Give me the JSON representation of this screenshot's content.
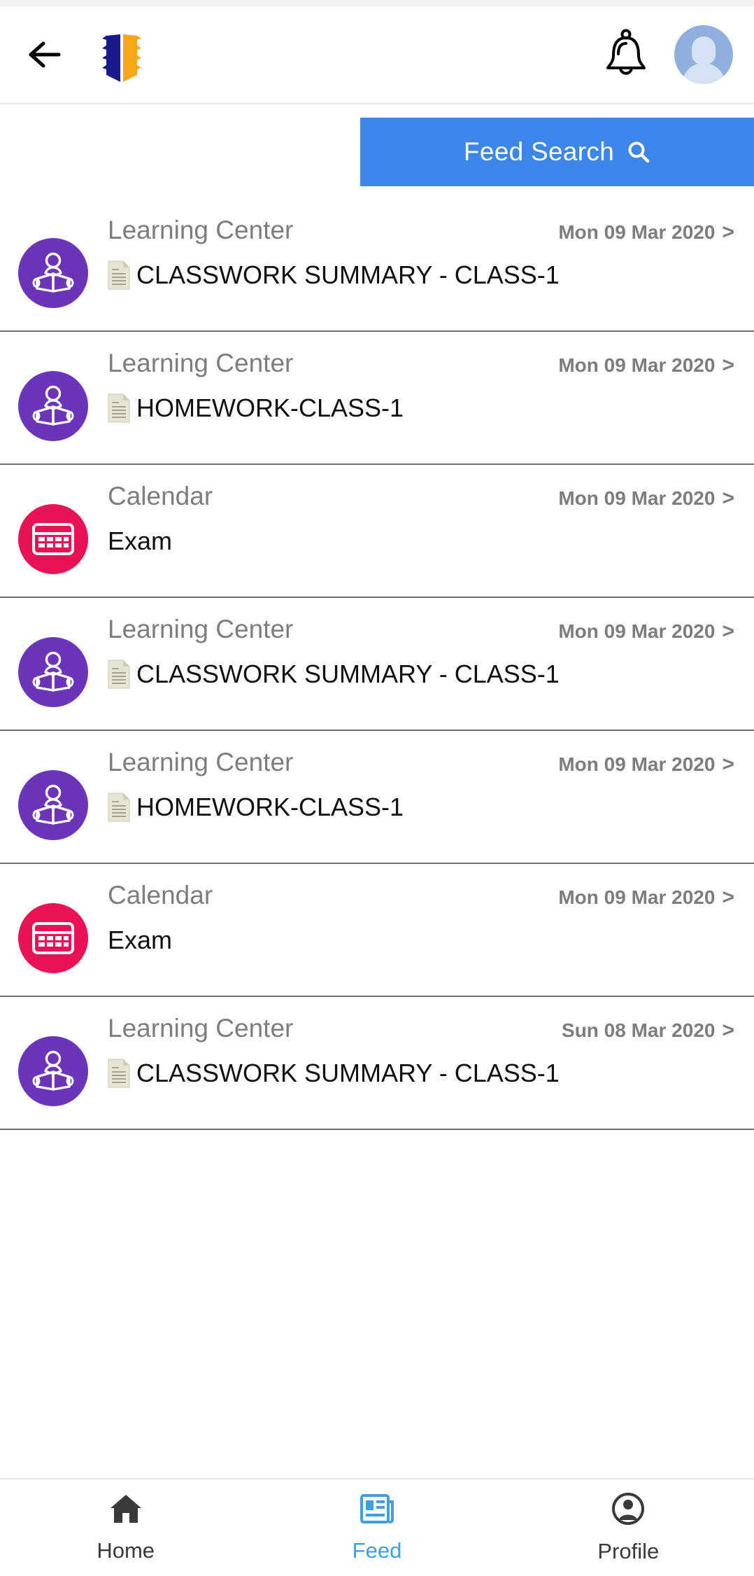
{
  "header": {
    "back_icon": "back-arrow-icon",
    "logo_icon": "open-book-logo",
    "logo_colors": {
      "left": "#1a1a8c",
      "right": "#f9a619"
    },
    "bell_icon": "notification-bell-icon",
    "avatar_icon": "user-avatar",
    "avatar_color": "#8fb0dd"
  },
  "search": {
    "label": "Feed Search",
    "icon": "search-icon",
    "background": "#3b86e8",
    "text_color": "#ffffff"
  },
  "feed": {
    "items": [
      {
        "source": "Learning Center",
        "date": "Mon 09 Mar 2020",
        "chevron": ">",
        "title": "CLASSWORK SUMMARY - CLASS-1",
        "icon": "reading-person-icon",
        "icon_color": "#6a35b8",
        "has_document_icon": true
      },
      {
        "source": "Learning Center",
        "date": "Mon 09 Mar 2020",
        "chevron": ">",
        "title": "HOMEWORK-CLASS-1",
        "icon": "reading-person-icon",
        "icon_color": "#6a35b8",
        "has_document_icon": true
      },
      {
        "source": "Calendar",
        "date": "Mon 09 Mar 2020",
        "chevron": ">",
        "title": "Exam",
        "icon": "calendar-icon",
        "icon_color": "#ea1155",
        "has_document_icon": false
      },
      {
        "source": "Learning Center",
        "date": "Mon 09 Mar 2020",
        "chevron": ">",
        "title": "CLASSWORK SUMMARY - CLASS-1",
        "icon": "reading-person-icon",
        "icon_color": "#6a35b8",
        "has_document_icon": true
      },
      {
        "source": "Learning Center",
        "date": "Mon 09 Mar 2020",
        "chevron": ">",
        "title": "HOMEWORK-CLASS-1",
        "icon": "reading-person-icon",
        "icon_color": "#6a35b8",
        "has_document_icon": true
      },
      {
        "source": "Calendar",
        "date": "Mon 09 Mar 2020",
        "chevron": ">",
        "title": "Exam",
        "icon": "calendar-icon",
        "icon_color": "#ea1155",
        "has_document_icon": false
      },
      {
        "source": "Learning Center",
        "date": "Sun 08 Mar 2020",
        "chevron": ">",
        "title": "CLASSWORK SUMMARY - CLASS-1",
        "icon": "reading-person-icon",
        "icon_color": "#6a35b8",
        "has_document_icon": true
      }
    ]
  },
  "bottom_nav": {
    "active": "Feed",
    "active_color": "#3ba0e4",
    "items": [
      {
        "label": "Home",
        "icon": "home-icon",
        "active": false
      },
      {
        "label": "Feed",
        "icon": "newspaper-icon",
        "active": true
      },
      {
        "label": "Profile",
        "icon": "person-circle-icon",
        "active": false
      }
    ]
  }
}
